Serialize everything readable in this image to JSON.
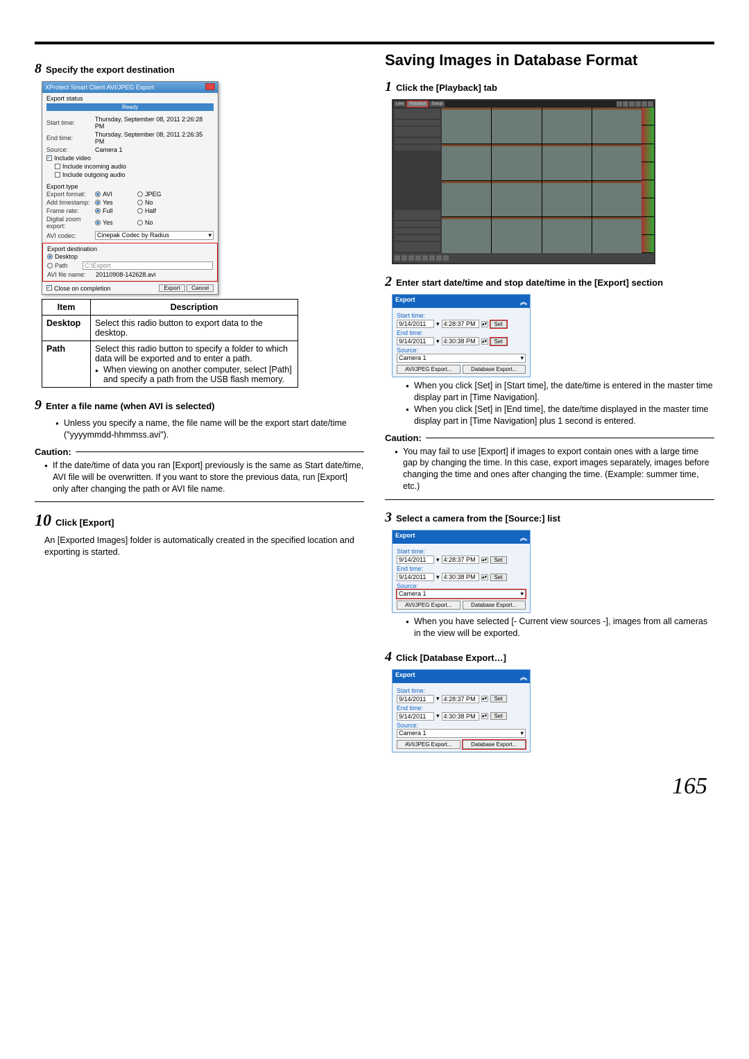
{
  "page_number": "165",
  "left": {
    "step8": {
      "num": "8",
      "text": "Specify the export destination"
    },
    "dialog": {
      "title": "XProtect Smart Client AVI/JPEG Export",
      "export_status_label": "Export status",
      "ready": "Ready",
      "start_time_label": "Start time:",
      "start_time_value": "Thursday, September 08, 2011 2:26:28 PM",
      "end_time_label": "End time:",
      "end_time_value": "Thursday, September 08, 2011 2:26:35 PM",
      "source_label": "Source:",
      "source_value": "Camera 1",
      "include_video": "Include video",
      "include_incoming_audio": "Include incoming audio",
      "include_outgoing_audio": "Include outgoing audio",
      "export_type_label": "Export type",
      "export_format_label": "Export format:",
      "avi": "AVI",
      "jpeg": "JPEG",
      "add_timestamp_label": "Add timestamp:",
      "yes": "Yes",
      "no": "No",
      "frame_rate_label": "Frame rate:",
      "full": "Full",
      "half": "Half",
      "digital_zoom_label": "Digital zoom export:",
      "avi_codec_label": "AVI codec:",
      "avi_codec_value": "Cinepak Codec by Radius",
      "export_dest_label": "Export destination",
      "desktop": "Desktop",
      "path": "Path",
      "path_value": "C:\\Export",
      "avi_file_name_label": "AVI file name:",
      "avi_file_name_value": "20110908-142628.avi",
      "close_on_completion": "Close on completion",
      "export_btn": "Export",
      "cancel_btn": "Cancel"
    },
    "table": {
      "h_item": "Item",
      "h_desc": "Description",
      "row1_item": "Desktop",
      "row1_desc": "Select this radio button to export data to the desktop.",
      "row2_item": "Path",
      "row2_desc_a": "Select this radio button to specify a folder to which data will be exported and to enter a path.",
      "row2_desc_b": "When viewing on another computer, select [Path] and specify a path from the USB flash memory."
    },
    "step9": {
      "num": "9",
      "text": "Enter a file name (when AVI is selected)",
      "bullet": "Unless you specify a name, the file name will be the export start date/time (\"yyyymmdd-hhmmss.avi\")."
    },
    "caution_label": "Caution:",
    "caution9": "If the date/time of data you ran [Export] previously is the same as Start date/time, AVI file will be overwritten. If you want to store the previous data, run [Export] only after changing the path or AVI file name.",
    "step10": {
      "num": "10",
      "text": "Click [Export]",
      "body": "An [Exported Images] folder is automatically created in the specified location and exporting is started."
    }
  },
  "right": {
    "section_title": "Saving Images in Database Format",
    "step1": {
      "num": "1",
      "text": "Click the [Playback] tab"
    },
    "playback": {
      "tab_live": "Live",
      "tab_playback": "Playback",
      "tab_setup": "Setup"
    },
    "step2": {
      "num": "2",
      "text": "Enter start date/time and stop date/time in the [Export] section"
    },
    "panel": {
      "header": "Export",
      "start_time": "Start time:",
      "start_date": "9/14/2011",
      "start_t": "4:28:37 PM",
      "end_time": "End time:",
      "end_date": "9/14/2011",
      "end_t": "4:30:38 PM",
      "source": "Source:",
      "camera": "Camera 1",
      "set": "Set",
      "avi_btn": "AVI/JPEG Export...",
      "db_btn": "Database Export..."
    },
    "step2_bullets": [
      "When you click [Set] in [Start time], the date/time is entered in the master time display part in [Time Navigation].",
      "When you click [Set] in [End time], the date/time displayed in the master time display part in [Time Navigation] plus 1 second is entered."
    ],
    "caution2": "You may fail to use [Export] if images to export contain ones with a large time gap by changing the time. In this case, export images separately, images before changing the time and ones after changing the time. (Example: summer time, etc.)",
    "step3": {
      "num": "3",
      "text": "Select a camera from the [Source:] list",
      "bullet": "When you have selected [- Current view sources -], images from all cameras in the view will be exported."
    },
    "step4": {
      "num": "4",
      "text": "Click [Database Export…]"
    }
  }
}
